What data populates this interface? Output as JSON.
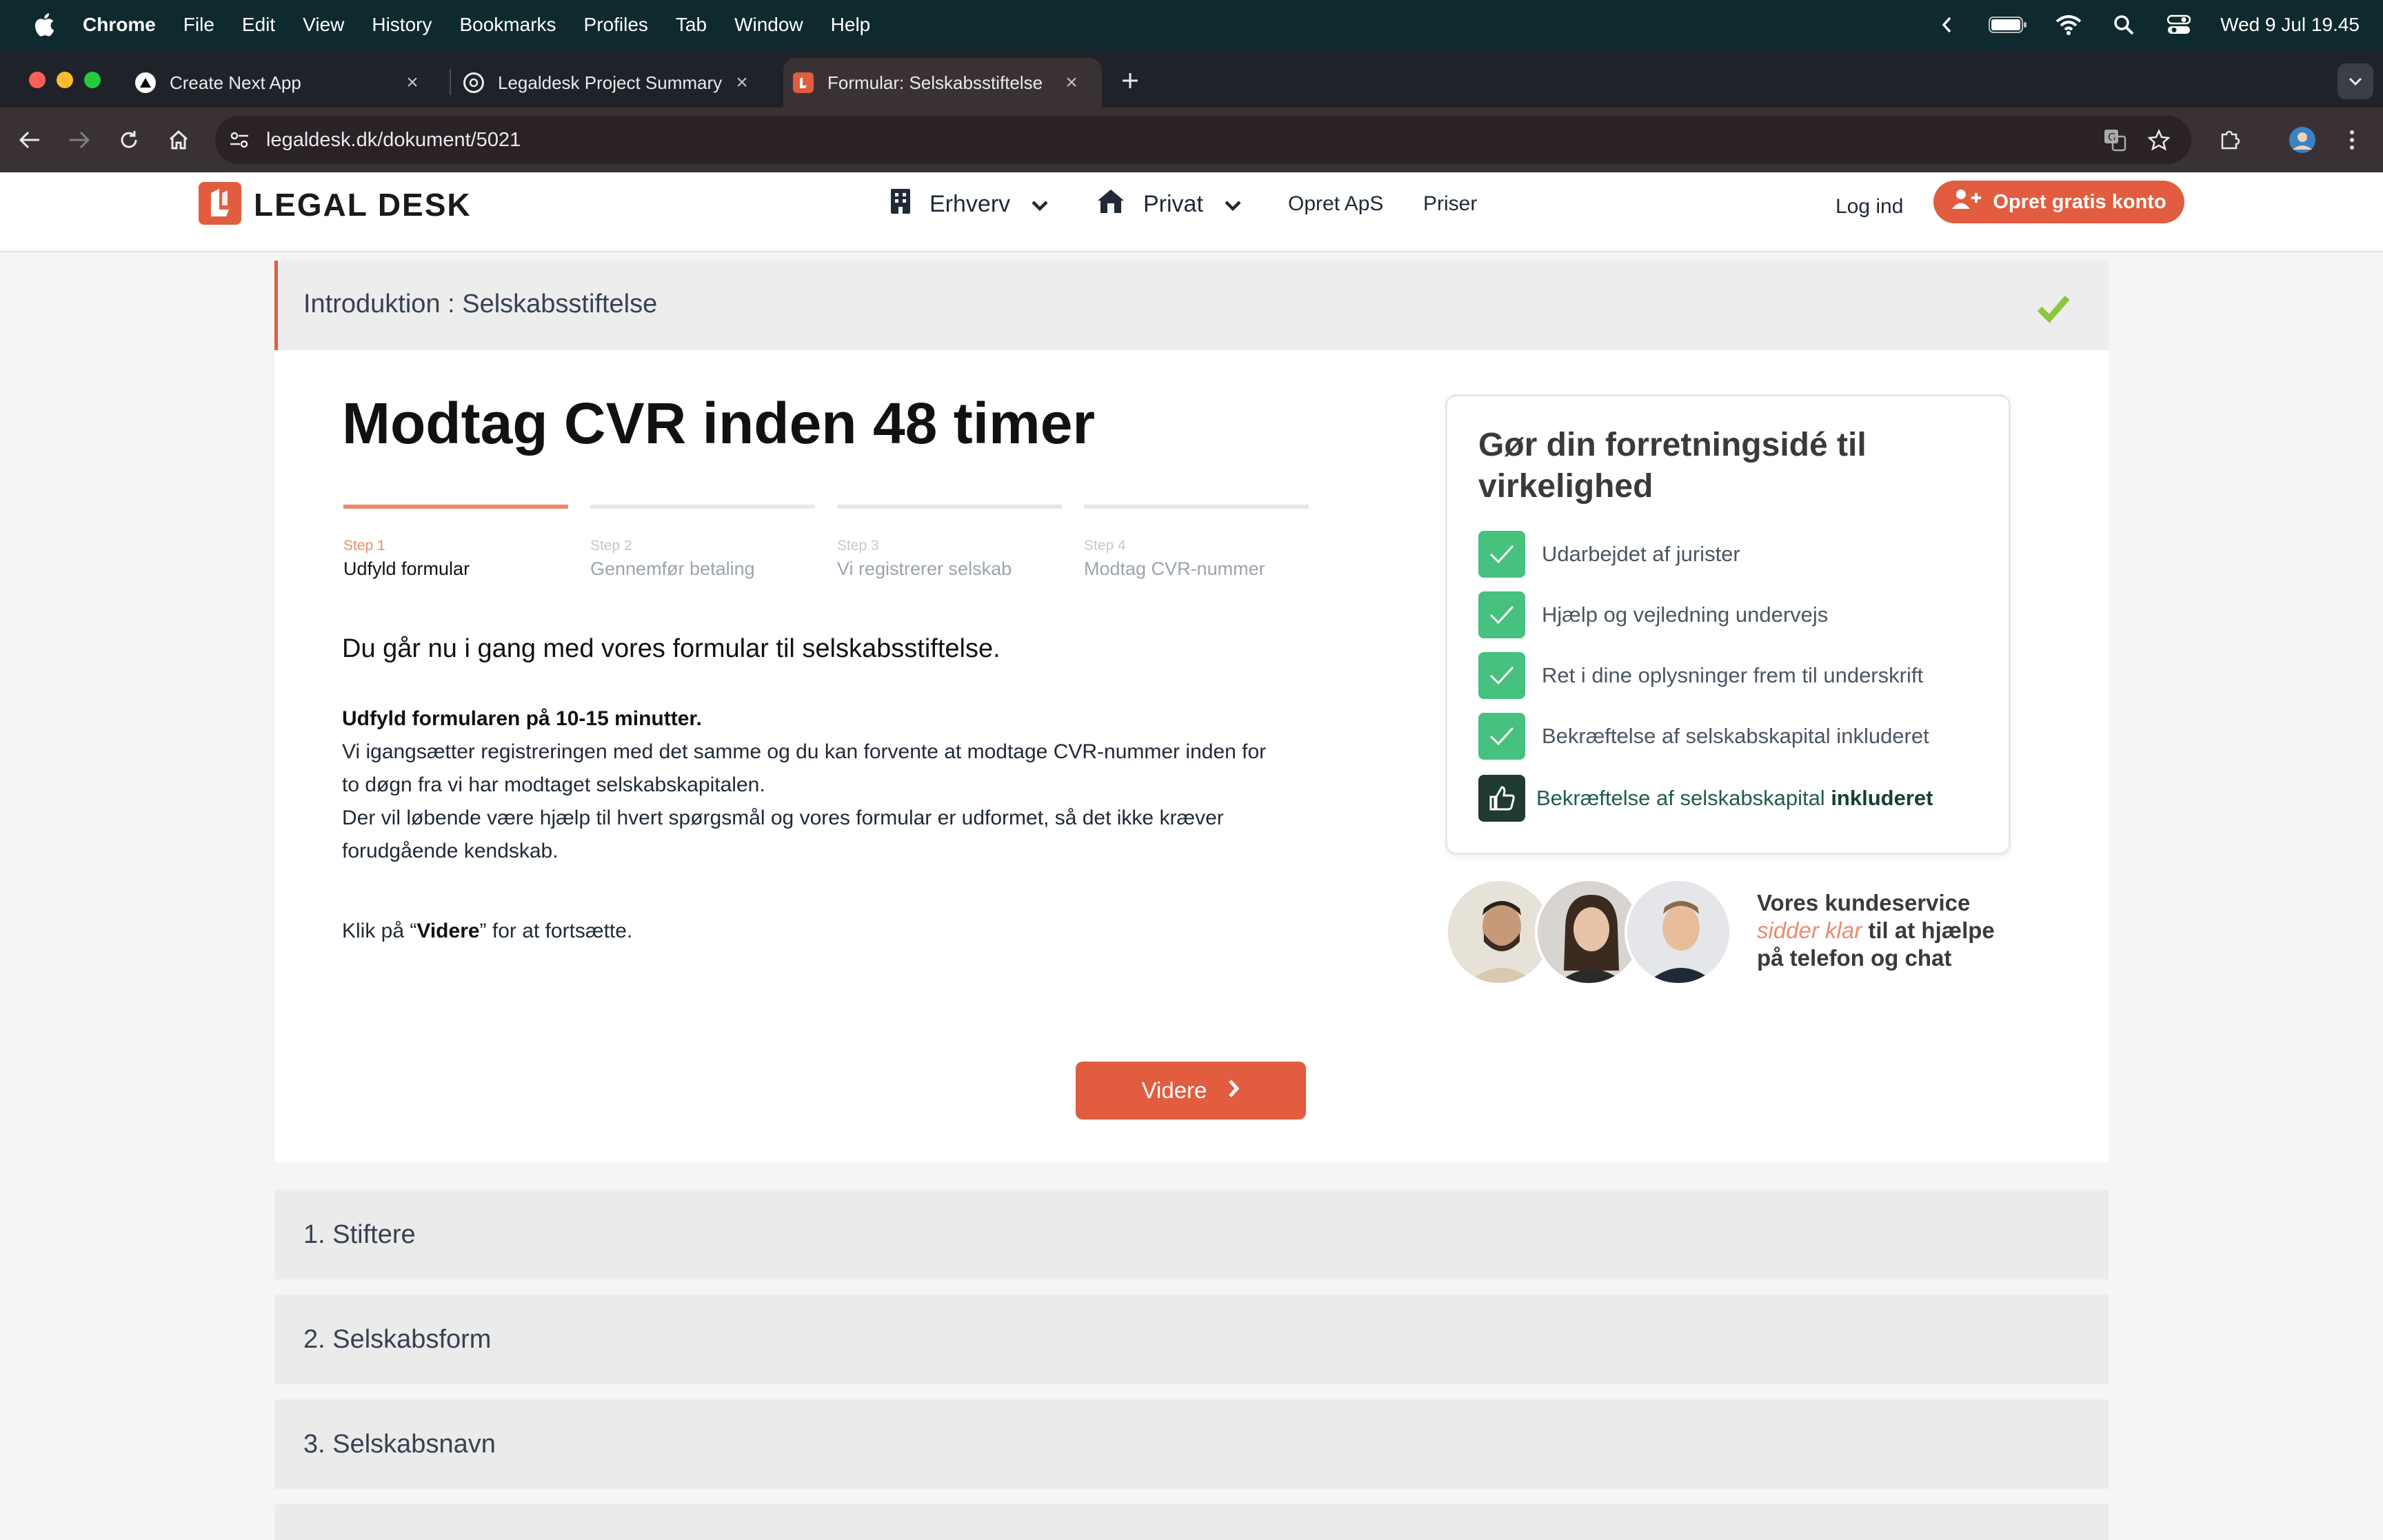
{
  "menubar": {
    "app": "Chrome",
    "items": [
      "File",
      "Edit",
      "View",
      "History",
      "Bookmarks",
      "Profiles",
      "Tab",
      "Window",
      "Help"
    ],
    "clock": "Wed 9 Jul  19.45"
  },
  "tabs": [
    {
      "title": "Create Next App"
    },
    {
      "title": "Legaldesk Project Summary"
    },
    {
      "title": "Formular: Selskabsstiftelse"
    }
  ],
  "address": {
    "url": "legaldesk.dk/dokument/5021"
  },
  "site": {
    "logo": "LEGAL DESK",
    "nav": {
      "erhverv": "Erhverv",
      "privat": "Privat",
      "opret_aps": "Opret ApS",
      "priser": "Priser",
      "login": "Log ind"
    },
    "cta": "Opret gratis konto"
  },
  "intro": {
    "title": "Introduktion : Selskabsstiftelse"
  },
  "main": {
    "heading": "Modtag CVR inden 48 timer",
    "steps": [
      {
        "num": "Step 1",
        "label": "Udfyld formular"
      },
      {
        "num": "Step 2",
        "label": "Gennemfør betaling"
      },
      {
        "num": "Step 3",
        "label": "Vi registrerer selskab"
      },
      {
        "num": "Step 4",
        "label": "Modtag CVR-nummer"
      }
    ],
    "lead": "Du går nu i gang med vores formular til selskabsstiftelse.",
    "p_bold": "Udfyld formularen på 10-15 minutter.",
    "p_line1": "Vi igangsætter registreringen med det samme og du kan forvente at modtage CVR-nummer inden for",
    "p_line2": "to døgn fra vi har modtaget selskabskapitalen.",
    "p_line3": "Der vil løbende være hjælp til hvert spørgsmål og vores formular er udformet, så det ikke kræver",
    "p_line4": "forudgående kendskab.",
    "continue_prefix": "Klik på “",
    "continue_bold": "Videre",
    "continue_suffix": "” for at fortsætte.",
    "next_button": "Videre"
  },
  "side": {
    "title": "Gør din forretningsidé til virkelighed",
    "features": [
      "Udarbejdet af jurister",
      "Hjælp og vejledning undervejs",
      "Ret i dine oplysninger frem til underskrift",
      "Bekræftelse af selskabskapital inkluderet"
    ],
    "feature_dark_prefix": "Bekræftelse af selskabskapital ",
    "feature_dark_bold": "inkluderet",
    "cs_line1": "Vores kundeservice",
    "cs_em": "sidder klar",
    "cs_line2": " til at hjælpe",
    "cs_line3": "på telefon og chat"
  },
  "sections": [
    "1. Stiftere",
    "2. Selskabsform",
    "3. Selskabsnavn"
  ],
  "colors": {
    "brand": "#e25c3f",
    "check": "#46c17e",
    "menubar": "#0f2a2e"
  }
}
